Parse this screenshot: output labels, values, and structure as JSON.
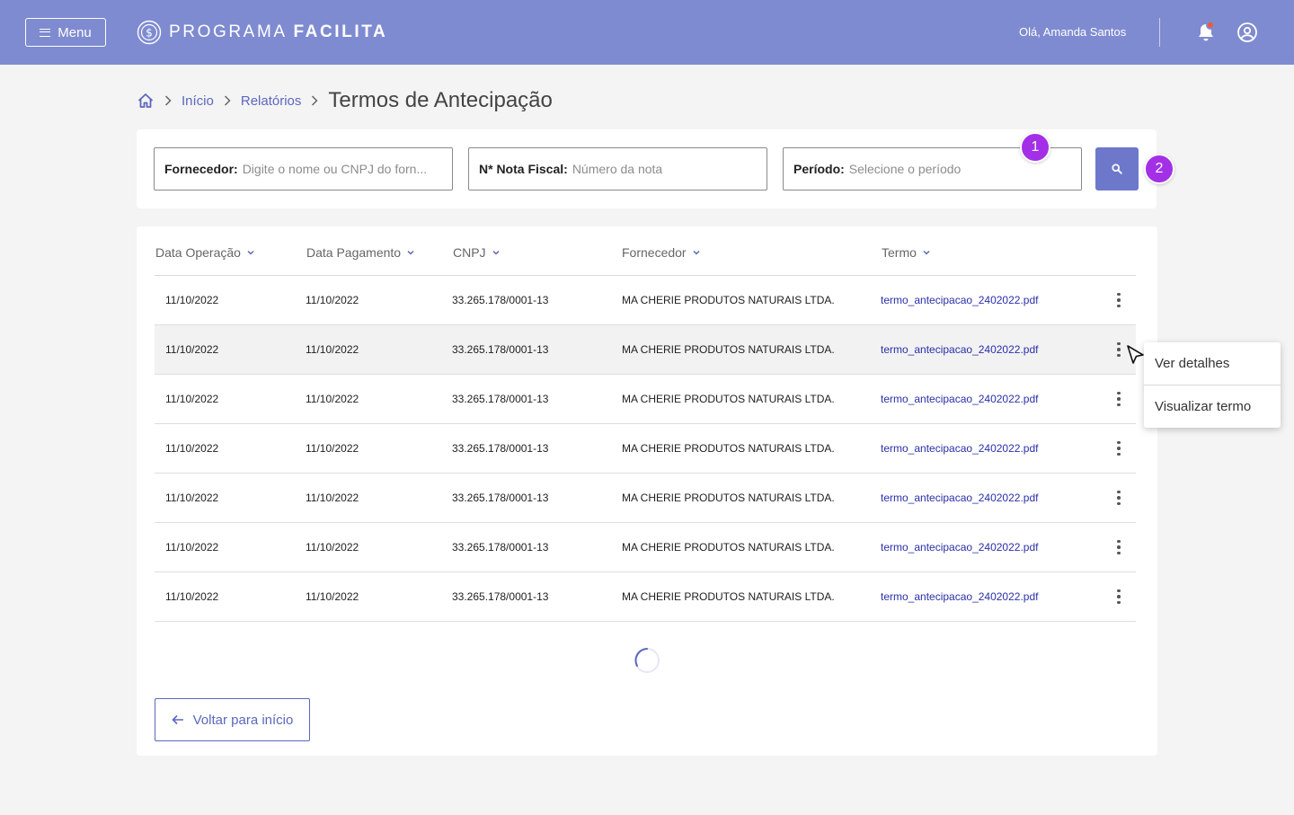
{
  "header": {
    "menu_label": "Menu",
    "brand_light": "PROGRAMA",
    "brand_bold": "FACILITA",
    "greeting": "Olá, Amanda Santos"
  },
  "breadcrumb": {
    "items": [
      "Início",
      "Relatórios"
    ],
    "current": "Termos de Antecipação"
  },
  "filters": {
    "fornecedor": {
      "label": "Fornecedor:",
      "placeholder": "Digite o nome ou CNPJ do forn..."
    },
    "nota": {
      "label": "N* Nota Fiscal:",
      "placeholder": "Número da nota"
    },
    "periodo": {
      "label": "Período:",
      "placeholder": "Selecione o período"
    },
    "badges": [
      "1",
      "2"
    ]
  },
  "table": {
    "columns": [
      "Data Operação",
      "Data Pagamento",
      "CNPJ",
      "Fornecedor",
      "Termo"
    ],
    "rows": [
      {
        "data_operacao": "11/10/2022",
        "data_pagamento": "11/10/2022",
        "cnpj": "33.265.178/0001-13",
        "fornecedor": "MA CHERIE PRODUTOS NATURAIS LTDA.",
        "termo": "termo_antecipacao_2402022.pdf"
      },
      {
        "data_operacao": "11/10/2022",
        "data_pagamento": "11/10/2022",
        "cnpj": "33.265.178/0001-13",
        "fornecedor": "MA CHERIE PRODUTOS NATURAIS LTDA.",
        "termo": "termo_antecipacao_2402022.pdf"
      },
      {
        "data_operacao": "11/10/2022",
        "data_pagamento": "11/10/2022",
        "cnpj": "33.265.178/0001-13",
        "fornecedor": "MA CHERIE PRODUTOS NATURAIS LTDA.",
        "termo": "termo_antecipacao_2402022.pdf"
      },
      {
        "data_operacao": "11/10/2022",
        "data_pagamento": "11/10/2022",
        "cnpj": "33.265.178/0001-13",
        "fornecedor": "MA CHERIE PRODUTOS NATURAIS LTDA.",
        "termo": "termo_antecipacao_2402022.pdf"
      },
      {
        "data_operacao": "11/10/2022",
        "data_pagamento": "11/10/2022",
        "cnpj": "33.265.178/0001-13",
        "fornecedor": "MA CHERIE PRODUTOS NATURAIS LTDA.",
        "termo": "termo_antecipacao_2402022.pdf"
      },
      {
        "data_operacao": "11/10/2022",
        "data_pagamento": "11/10/2022",
        "cnpj": "33.265.178/0001-13",
        "fornecedor": "MA CHERIE PRODUTOS NATURAIS LTDA.",
        "termo": "termo_antecipacao_2402022.pdf"
      },
      {
        "data_operacao": "11/10/2022",
        "data_pagamento": "11/10/2022",
        "cnpj": "33.265.178/0001-13",
        "fornecedor": "MA CHERIE PRODUTOS NATURAIS LTDA.",
        "termo": "termo_antecipacao_2402022.pdf"
      }
    ],
    "highlighted_row": 1
  },
  "context_menu": {
    "items": [
      "Ver detalhes",
      "Visualizar termo"
    ]
  },
  "back_button": {
    "label": "Voltar para início"
  },
  "colors": {
    "header_bg": "#7f8bd0",
    "accent": "#5c67be",
    "badge": "#a330e6",
    "notification": "#ee5a36",
    "link": "#2a2fa8"
  }
}
